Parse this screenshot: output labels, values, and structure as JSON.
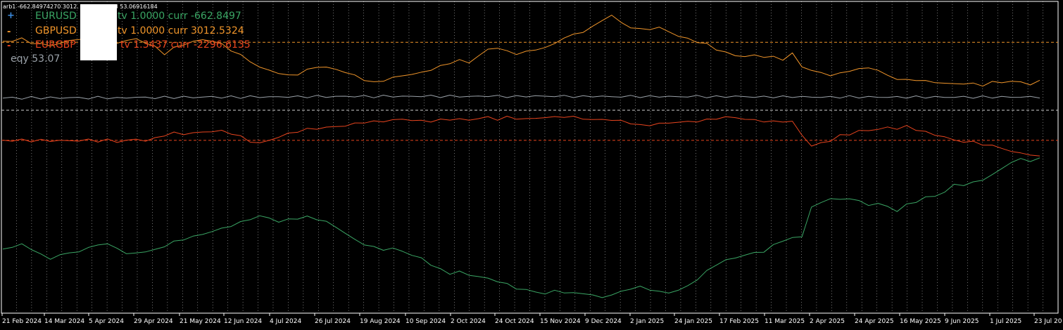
{
  "header": {
    "text": "arb1 -662.84974270 3012.                    96.61346828 53.06916184"
  },
  "colors": {
    "background": "#000000",
    "grid": "#ffffff",
    "eurusd": "#3aa564",
    "gbpusd": "#f0952a",
    "eurgbp": "#e8441e",
    "equity": "#9aa1a8",
    "axis_text": "#ffffff"
  },
  "legend": [
    {
      "marker": "+",
      "marker_color": "#3d8ce0",
      "symbol": "EURUSD",
      "text": "tv 1.0000 curr -662.8497",
      "color": "#3aa564"
    },
    {
      "marker": "-",
      "marker_color": "#f0952a",
      "symbol": "GBPUSD",
      "text": "tv 1.0000 curr 3012.5324",
      "color": "#f0952a"
    },
    {
      "marker": "-",
      "marker_color": "#e8441e",
      "symbol": "EURGBP",
      "text": "tv 1.3437 curr -2296.6135",
      "color": "#e8441e"
    },
    {
      "marker": "",
      "marker_color": "#9aa1a8",
      "symbol": "",
      "text": "eqy 53.07",
      "color": "#9aa1a8"
    }
  ],
  "chart_data": {
    "type": "line",
    "x_tick_labels": [
      "21 Feb 2024",
      "14 Mar 2024",
      "5 Apr 2024",
      "29 Apr 2024",
      "21 May 2024",
      "12 Jun 2024",
      "4 Jul 2024",
      "26 Jul 2024",
      "19 Aug 2024",
      "10 Sep 2024",
      "2 Oct 2024",
      "24 Oct 2024",
      "15 Nov 2024",
      "9 Dec 2024",
      "2 Jan 2025",
      "24 Jan 2025",
      "17 Feb 2025",
      "11 Mar 2025",
      "2 Apr 2025",
      "24 Apr 2025",
      "16 May 2025",
      "9 Jun 2025",
      "1 Jul 2025",
      "23 Jul 20"
    ],
    "grid": true,
    "levels": [
      {
        "name": "GBPUSD",
        "value": 3012.5324,
        "style": "dashed"
      },
      {
        "name": "EURGBP",
        "value": -2296.6135,
        "style": "dashed"
      },
      {
        "name": "EURUSD",
        "value": -662.8497,
        "style": "dashed"
      }
    ],
    "series": [
      {
        "name": "GBPUSD",
        "values": [
          3050,
          3100,
          3200,
          3000,
          2900,
          2850,
          2950,
          3100,
          3200,
          3150,
          3050,
          2950,
          3000,
          3100,
          3200,
          3000,
          2750,
          2400,
          2700,
          2900,
          3050,
          3150,
          3100,
          2900,
          2600,
          2300,
          2000,
          1650,
          1500,
          1350,
          1200,
          1300,
          1500,
          1700,
          1650,
          1550,
          1400,
          1200,
          1000,
          820,
          950,
          1100,
          1200,
          1300,
          1350,
          1550,
          1700,
          1900,
          2050,
          1900,
          2300,
          2600,
          2750,
          2500,
          2400,
          2500,
          2600,
          2750,
          2900,
          3300,
          3400,
          3600,
          3850,
          4200,
          4500,
          4050,
          3850,
          3700,
          3750,
          3800,
          3600,
          3350,
          3200,
          3050,
          2900,
          2650,
          2450,
          2300,
          2250,
          2300,
          2250,
          2200,
          2100,
          2400,
          1700,
          1500,
          1350,
          1250,
          1300,
          1500,
          1550,
          1650,
          1500,
          1200,
          1050,
          950,
          1000,
          900,
          850,
          800,
          750,
          800,
          750,
          700,
          850,
          850,
          900,
          850,
          750,
          900
        ]
      },
      {
        "name": "EURGBP",
        "values": [
          -2300,
          -2300,
          -2280,
          -2320,
          -2290,
          -2320,
          -2300,
          -2330,
          -2300,
          -2280,
          -2330,
          -2270,
          -2370,
          -2300,
          -2240,
          -2310,
          -2200,
          -2000,
          -1900,
          -1950,
          -1900,
          -1850,
          -1800,
          -1800,
          -1900,
          -2100,
          -2350,
          -2450,
          -2300,
          -2100,
          -1950,
          -1800,
          -1700,
          -1650,
          -1600,
          -1550,
          -1500,
          -1400,
          -1300,
          -1300,
          -1250,
          -1200,
          -1150,
          -1200,
          -1250,
          -1250,
          -1200,
          -1150,
          -1150,
          -1200,
          -1100,
          -1050,
          -1150,
          -1050,
          -1100,
          -1150,
          -1100,
          -1050,
          -1050,
          -1000,
          -1050,
          -1100,
          -1200,
          -1150,
          -1200,
          -1250,
          -1350,
          -1500,
          -1450,
          -1400,
          -1350,
          -1300,
          -1300,
          -1250,
          -1200,
          -1100,
          -1050,
          -1050,
          -1150,
          -1200,
          -1250,
          -1300,
          -1250,
          -1300,
          -2000,
          -2600,
          -2450,
          -2300,
          -2050,
          -1950,
          -1800,
          -1750,
          -1700,
          -1600,
          -1650,
          -1550,
          -1700,
          -1850,
          -2000,
          -2100,
          -2300,
          -2350,
          -2400,
          -2500,
          -2600,
          -2700,
          -2900,
          -3000,
          -3050,
          -3200
        ]
      },
      {
        "name": "EURUSD",
        "values": [
          -8200,
          -8050,
          -7950,
          -8150,
          -8500,
          -8700,
          -8500,
          -8400,
          -8300,
          -8150,
          -7900,
          -7950,
          -8100,
          -8450,
          -8400,
          -8300,
          -8250,
          -8000,
          -7800,
          -7650,
          -7500,
          -7400,
          -7200,
          -7100,
          -6900,
          -6750,
          -6550,
          -6400,
          -6500,
          -6700,
          -6600,
          -6500,
          -6450,
          -6550,
          -6700,
          -7000,
          -7300,
          -7700,
          -7900,
          -8100,
          -8200,
          -8150,
          -8300,
          -8500,
          -8700,
          -9000,
          -9300,
          -9500,
          -9400,
          -9600,
          -9650,
          -9800,
          -9900,
          -10100,
          -10300,
          -10400,
          -10500,
          -10600,
          -10450,
          -10500,
          -10600,
          -10550,
          -10700,
          -10800,
          -10650,
          -10500,
          -10300,
          -10250,
          -10350,
          -10500,
          -10550,
          -10400,
          -10200,
          -9800,
          -9400,
          -9000,
          -8800,
          -8650,
          -8500,
          -8400,
          -8300,
          -8000,
          -7700,
          -7600,
          -7500,
          -5900,
          -5700,
          -5400,
          -5550,
          -5400,
          -5600,
          -5800,
          -5700,
          -5900,
          -6100,
          -5800,
          -5600,
          -5400,
          -5300,
          -5100,
          -4700,
          -4700,
          -4600,
          -4400,
          -4200,
          -3800,
          -3500,
          -3300,
          -3400,
          -3300
        ]
      },
      {
        "name": "eqy",
        "values": [
          0,
          10,
          -15,
          20,
          0,
          15,
          -10,
          25,
          5,
          -5,
          30,
          10,
          -20,
          15,
          40,
          20,
          10,
          35,
          25,
          50,
          30,
          45,
          60,
          40,
          55,
          35,
          70,
          50,
          65,
          45,
          80,
          55,
          70,
          90,
          60,
          85,
          75,
          95,
          80,
          70,
          100,
          85,
          90,
          75,
          110,
          95,
          80,
          100,
          85,
          70,
          95,
          110,
          90,
          80,
          75,
          95,
          105,
          85,
          100,
          90,
          80,
          70,
          95,
          85,
          60,
          75,
          90,
          80,
          70,
          85,
          75,
          65,
          80,
          90,
          70,
          60,
          75,
          85,
          70,
          60,
          50,
          65,
          55,
          70,
          60,
          45,
          55,
          40,
          50,
          65,
          45,
          55,
          40,
          50,
          35,
          45,
          55,
          40,
          50,
          35,
          45,
          50,
          40,
          55,
          45,
          50,
          45,
          53,
          50,
          53
        ]
      }
    ]
  }
}
